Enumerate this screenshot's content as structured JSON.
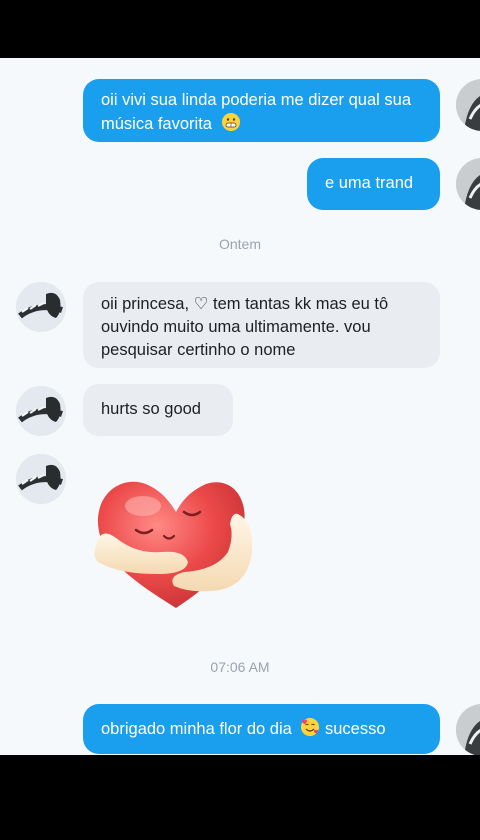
{
  "messages": {
    "m1": {
      "text": "oii vivi sua linda poderia  me dizer qual sua música  favorita",
      "emoji": "😬"
    },
    "m2": {
      "text": "e uma trand"
    },
    "m3": {
      "text": "oii princesa, ♡ tem tantas kk mas eu tô ouvindo muito uma ultimamente.  vou pesquisar certinho o nome"
    },
    "m4": {
      "text": "hurts so good"
    },
    "m6": {
      "text_before": "obrigado  minha flor do dia",
      "emoji": "🥰",
      "text_after": "sucesso"
    }
  },
  "dividers": {
    "yesterday": "Ontem",
    "time": "07:06 AM"
  },
  "sticker": {
    "icon": "heart-hug-sticker"
  },
  "colors": {
    "outgoing_bubble": "#1a9fee",
    "incoming_bubble": "#e9edf1",
    "chat_background": "#f5f9fc",
    "meta_text": "#9aa3ab"
  }
}
